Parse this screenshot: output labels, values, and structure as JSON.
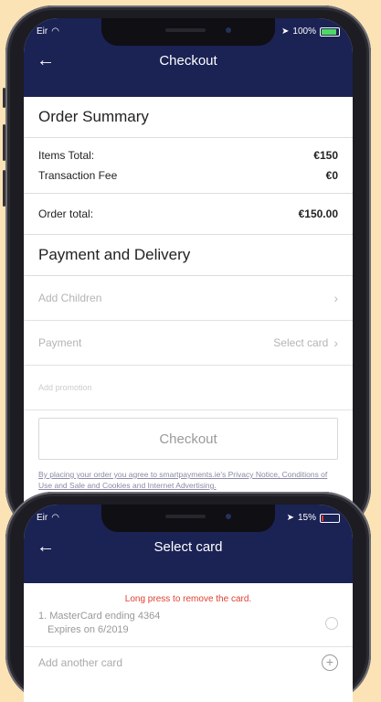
{
  "phone1": {
    "status": {
      "carrier": "Eir",
      "battery": "100%",
      "battery_level": 1.0
    },
    "title": "Checkout",
    "order_summary": {
      "heading": "Order Summary",
      "items_total_label": "Items Total:",
      "items_total_value": "€150",
      "fee_label": "Transaction Fee",
      "fee_value": "€0",
      "order_total_label": "Order total:",
      "order_total_value": "€150.00"
    },
    "payment_delivery": {
      "heading": "Payment and Delivery",
      "add_children_label": "Add Children",
      "payment_label": "Payment",
      "payment_value": "Select card",
      "promo_placeholder": "Add promotion"
    },
    "checkout_label": "Checkout",
    "legal_text": "By placing your order you agree to smartpayments.ie's Privacy Notice, Conditions of Use and Sale and Cookies and Internet Advertising."
  },
  "phone2": {
    "status": {
      "carrier": "Eir",
      "battery": "15%",
      "battery_level": 0.15
    },
    "title": "Select card",
    "hint": "Long press to remove the card.",
    "cards": [
      {
        "index": "1.",
        "name": "MasterCard ending 4364",
        "expiry": "Expires on 6/2019"
      }
    ],
    "add_card_label": "Add another card"
  },
  "colors": {
    "background": "#fbe3b5",
    "navbar": "#1b2254",
    "hint_red": "#e04030",
    "battery_green": "#4cd964",
    "battery_red": "#e0352b"
  },
  "icons": [
    "back-arrow-icon",
    "wifi-icon",
    "location-arrow-icon",
    "battery-icon",
    "chevron-right-icon",
    "radio-icon",
    "plus-circle-icon"
  ]
}
